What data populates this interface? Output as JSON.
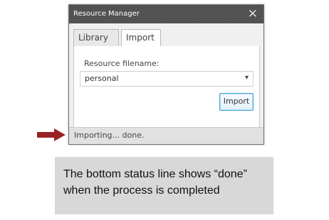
{
  "window": {
    "title": "Resource Manager",
    "close_symbol": "✕"
  },
  "tabs": [
    {
      "label": "Library"
    },
    {
      "label": "Import"
    }
  ],
  "form": {
    "field_label": "Resource filename:",
    "selected_value": "personal",
    "caret_symbol": "▾",
    "import_button_label": "Import"
  },
  "status": {
    "text": "Importing... done."
  },
  "annotation": {
    "text": "The bottom status line shows “done” when the process is completed"
  },
  "colors": {
    "arrow": "#9b2222",
    "accent_button_border": "#3f9fd6"
  },
  "icons": {
    "pointer": "arrow-right-icon",
    "close": "close-icon",
    "dropdown": "chevron-down-icon"
  }
}
